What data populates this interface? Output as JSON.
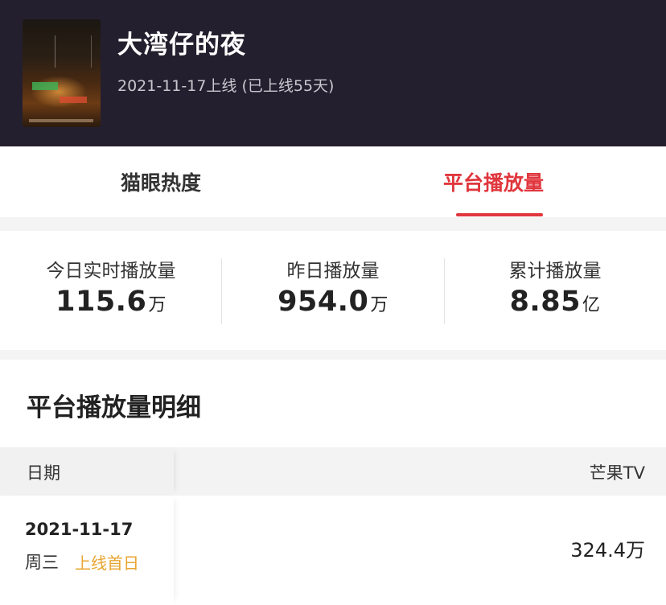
{
  "movie": {
    "title": "大湾仔的夜",
    "release_info": "2021-11-17上线 (已上线55天)"
  },
  "tabs": [
    {
      "label": "猫眼热度",
      "active": false
    },
    {
      "label": "平台播放量",
      "active": true
    }
  ],
  "stats": [
    {
      "label": "今日实时播放量",
      "value": "115.6",
      "unit": "万"
    },
    {
      "label": "昨日播放量",
      "value": "954.0",
      "unit": "万"
    },
    {
      "label": "累计播放量",
      "value": "8.85",
      "unit": "亿"
    }
  ],
  "detail": {
    "title": "平台播放量明细",
    "columns": [
      "日期",
      "芒果TV"
    ],
    "rows": [
      {
        "date": "2021-11-17",
        "weekday": "周三",
        "tag": "上线首日",
        "mgtv": "324.4万"
      }
    ]
  },
  "colors": {
    "header_bg": "#241f2e",
    "accent": "#e0363d",
    "tag": "#e8a531"
  }
}
